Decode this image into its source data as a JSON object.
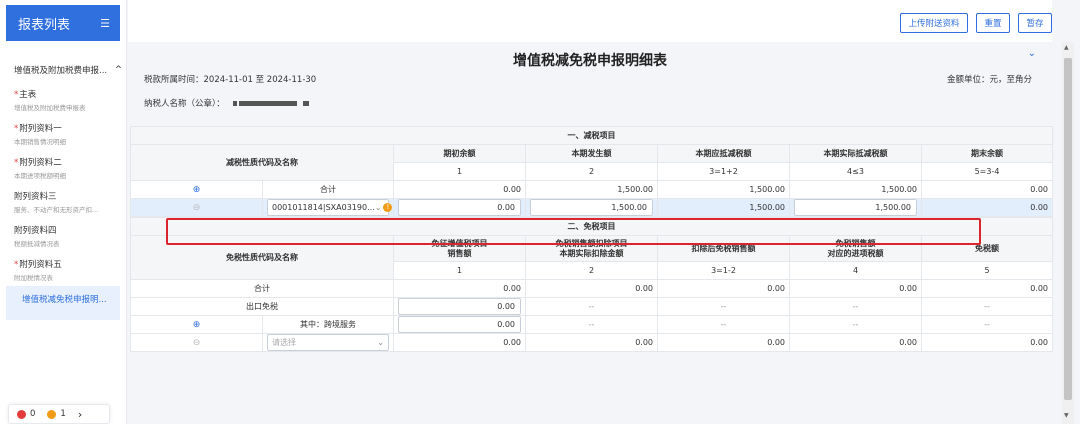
{
  "sidebar": {
    "title": "报表列表",
    "group_title": "增值税及附加税费申报...",
    "items": [
      {
        "title": "主表",
        "required": true,
        "subtitle": "增值税及附加税费申报表"
      },
      {
        "title": "附列资料一",
        "required": true,
        "subtitle": "本期销售情况明细"
      },
      {
        "title": "附列资料二",
        "required": true,
        "subtitle": "本期进项税额明细"
      },
      {
        "title": "附列资料三",
        "required": false,
        "subtitle": "服务、不动产和无形资产扣..."
      },
      {
        "title": "附列资料四",
        "required": false,
        "subtitle": "税额抵减情况表"
      },
      {
        "title": "附列资料五",
        "required": true,
        "subtitle": "附加税情况表"
      }
    ],
    "active_item": "增值税减免税申报明..."
  },
  "status": {
    "errors": "0",
    "warnings": "1",
    "next": "›"
  },
  "toolbar": {
    "upload_label": "上传附送资料",
    "reset_label": "重置",
    "save_label": "暂存"
  },
  "header": {
    "title": "增值税减免税申报明细表",
    "period": "税款所属时间：2024-11-01 至 2024-11-30",
    "unit": "金额单位：元，至角分",
    "taxpayer_label": "纳税人名称（公章）："
  },
  "reduction": {
    "section_title": "一、减税项目",
    "name_header": "减税性质代码及名称",
    "columns": [
      "期初余额",
      "本期发生额",
      "本期应抵减税额",
      "本期实际抵减税额",
      "期末余额"
    ],
    "col_numbers": [
      "1",
      "2",
      "3=1+2",
      "4≤3",
      "5=3-4"
    ],
    "total_label": "合计",
    "total_values": [
      "0.00",
      "1,500.00",
      "1,500.00",
      "1,500.00",
      "0.00"
    ],
    "row": {
      "code": "0001011814|SXA03190...",
      "opening": "0.00",
      "current": "1,500.00",
      "deductible": "1,500.00",
      "actual": "1,500.00",
      "ending": "0.00"
    }
  },
  "exemption": {
    "section_title": "二、免税项目",
    "name_header": "免税性质代码及名称",
    "columns": [
      "免征增值税项目\n销售额",
      "免税销售额扣除项目\n本期实际扣除金额",
      "扣除后免税销售额",
      "免税销售额\n对应的进项税额",
      "免税额"
    ],
    "col_numbers": [
      "1",
      "2",
      "3=1-2",
      "4",
      "5"
    ],
    "total_label": "合计",
    "total_values": [
      "0.00",
      "0.00",
      "0.00",
      "0.00",
      "0.00"
    ],
    "export_label": "出口免税",
    "export_values": [
      "0.00",
      "--",
      "--",
      "--",
      "--"
    ],
    "cross_border_label": "其中：跨境服务",
    "cross_border_values": [
      "0.00",
      "--",
      "--",
      "--",
      "--"
    ],
    "select_placeholder": "请选择",
    "last_values": [
      "0.00",
      "0.00",
      "0.00",
      "0.00",
      "0.00"
    ]
  }
}
